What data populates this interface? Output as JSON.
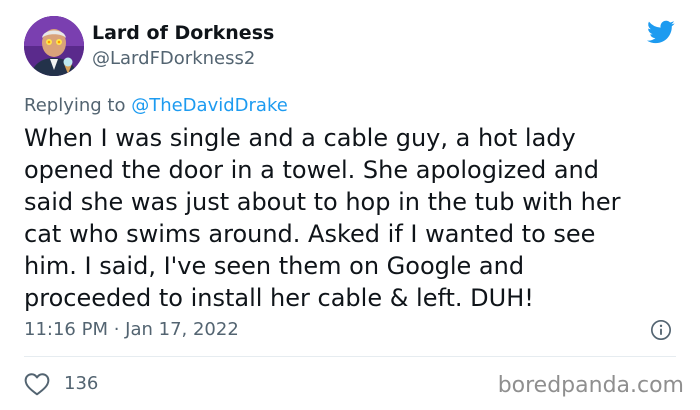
{
  "tweet": {
    "author": {
      "display_name": "Lard of Dorkness",
      "handle": "@LardFDorkness2",
      "avatar_icon": "avatar-icon"
    },
    "platform_icon": "twitter-bird-icon",
    "reply_context": {
      "prefix": "Replying to ",
      "mention": "@TheDavidDrake"
    },
    "body_lines": [
      "When I was single and a cable guy, a hot lady",
      "opened the door in a towel. She apologized and",
      "said she was just about to hop in the tub with her",
      "cat who swims around. Asked if I wanted to see",
      "him. I said, I've seen them on Google and",
      "proceeded to install her cable & left. DUH!"
    ],
    "timestamp": "11:16 PM · Jan 17, 2022",
    "info_icon": "info-icon",
    "likes": {
      "icon": "heart-icon",
      "count": "136"
    }
  },
  "watermark": "boredpanda.com",
  "colors": {
    "text_primary": "#0f1419",
    "text_secondary": "#536471",
    "link_blue": "#1d9bf0",
    "divider": "#e6ecf0",
    "watermark": "#8f8f8f"
  }
}
